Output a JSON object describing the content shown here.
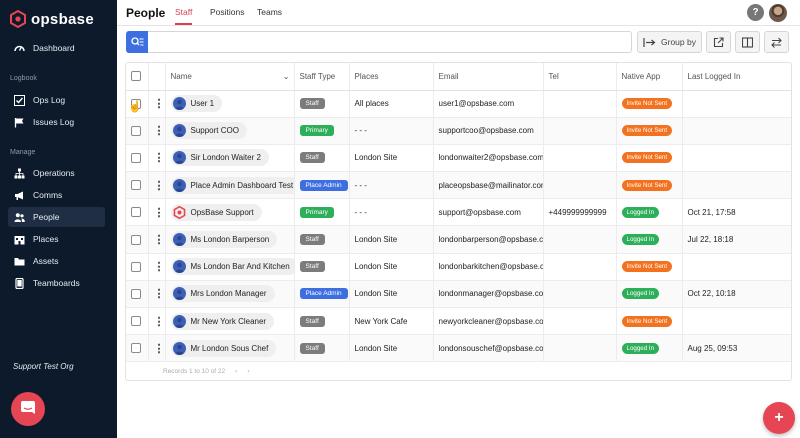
{
  "brand": {
    "name": "opsbase",
    "accent": "#e64553"
  },
  "sidebar": {
    "dashboard": {
      "label": "Dashboard",
      "icon": "dashboard-gauge-icon"
    },
    "logbook_label": "Logbook",
    "logbook": [
      {
        "label": "Ops Log",
        "icon": "checkbox-icon"
      },
      {
        "label": "Issues Log",
        "icon": "flag-icon"
      }
    ],
    "manage_label": "Manage",
    "manage": [
      {
        "label": "Operations",
        "icon": "org-chart-icon"
      },
      {
        "label": "Comms",
        "icon": "megaphone-icon"
      },
      {
        "label": "People",
        "icon": "people-icon",
        "active": true
      },
      {
        "label": "Places",
        "icon": "building-icon"
      },
      {
        "label": "Assets",
        "icon": "folder-icon"
      },
      {
        "label": "Teamboards",
        "icon": "tablet-icon"
      }
    ],
    "org_name": "Support Test Org"
  },
  "header": {
    "title": "People",
    "tabs": [
      {
        "label": "Staff",
        "active": true
      },
      {
        "label": "Positions"
      },
      {
        "label": "Teams"
      }
    ],
    "help_label": "?"
  },
  "toolbar": {
    "search_placeholder": "",
    "group_by_label": "Group by"
  },
  "table": {
    "columns": [
      "Name",
      "Staff Type",
      "Places",
      "Email",
      "Tel",
      "Native App",
      "Last Logged In"
    ],
    "rows": [
      {
        "name": "User 1",
        "avatar": "user",
        "staff_type": "Staff",
        "type_color": "grey",
        "places": "All places",
        "email": "user1@opsbase.com",
        "tel": "",
        "app": "Invite Not Sent",
        "app_color": "orange",
        "last": ""
      },
      {
        "name": "Support COO",
        "avatar": "user",
        "staff_type": "Primary",
        "type_color": "green",
        "places": "- - -",
        "email": "supportcoo@opsbase.com",
        "tel": "",
        "app": "Invite Not Sent",
        "app_color": "orange",
        "last": ""
      },
      {
        "name": "Sir London Waiter 2",
        "avatar": "user",
        "staff_type": "Staff",
        "type_color": "grey",
        "places": "London Site",
        "email": "londonwaiter2@opsbase.com",
        "tel": "",
        "app": "Invite Not Sent",
        "app_color": "orange",
        "last": ""
      },
      {
        "name": "Place Admin Dashboard Test",
        "avatar": "user",
        "staff_type": "Place Admin",
        "type_color": "blue",
        "places": "- - -",
        "email": "placeopsbase@mailinator.com",
        "tel": "",
        "app": "Invite Not Sent",
        "app_color": "orange",
        "last": ""
      },
      {
        "name": "OpsBase Support",
        "avatar": "logo",
        "staff_type": "Primary",
        "type_color": "green",
        "places": "- - -",
        "email": "support@opsbase.com",
        "tel": "+449999999999",
        "app": "Logged In",
        "app_color": "green",
        "last": "Oct 21, 17:58"
      },
      {
        "name": "Ms London Barperson",
        "avatar": "user",
        "staff_type": "Staff",
        "type_color": "grey",
        "places": "London Site",
        "email": "londonbarperson@opsbase.com",
        "tel": "",
        "app": "Logged In",
        "app_color": "green",
        "last": "Jul 22, 18:18"
      },
      {
        "name": "Ms London Bar And Kitchen",
        "avatar": "user",
        "staff_type": "Staff",
        "type_color": "grey",
        "places": "London Site",
        "email": "londonbarkitchen@opsbase.com",
        "tel": "",
        "app": "Invite Not Sent",
        "app_color": "orange",
        "last": ""
      },
      {
        "name": "Mrs London Manager",
        "avatar": "user",
        "staff_type": "Place Admin",
        "type_color": "blue",
        "places": "London Site",
        "email": "londonmanager@opsbase.com",
        "tel": "",
        "app": "Logged In",
        "app_color": "green",
        "last": "Oct 22, 10:18"
      },
      {
        "name": "Mr New York Cleaner",
        "avatar": "user",
        "staff_type": "Staff",
        "type_color": "grey",
        "places": "New York Cafe",
        "email": "newyorkcleaner@opsbase.com",
        "tel": "",
        "app": "Invite Not Sent",
        "app_color": "orange",
        "last": ""
      },
      {
        "name": "Mr London Sous Chef",
        "avatar": "user",
        "staff_type": "Staff",
        "type_color": "grey",
        "places": "London Site",
        "email": "londonsouschef@opsbase.com",
        "tel": "",
        "app": "Logged In",
        "app_color": "green",
        "last": "Aug 25, 09:53"
      }
    ],
    "records_label": "Records 1 to 10 of 22",
    "prev_label": "‹",
    "next_label": "›"
  },
  "fab_label": "+"
}
